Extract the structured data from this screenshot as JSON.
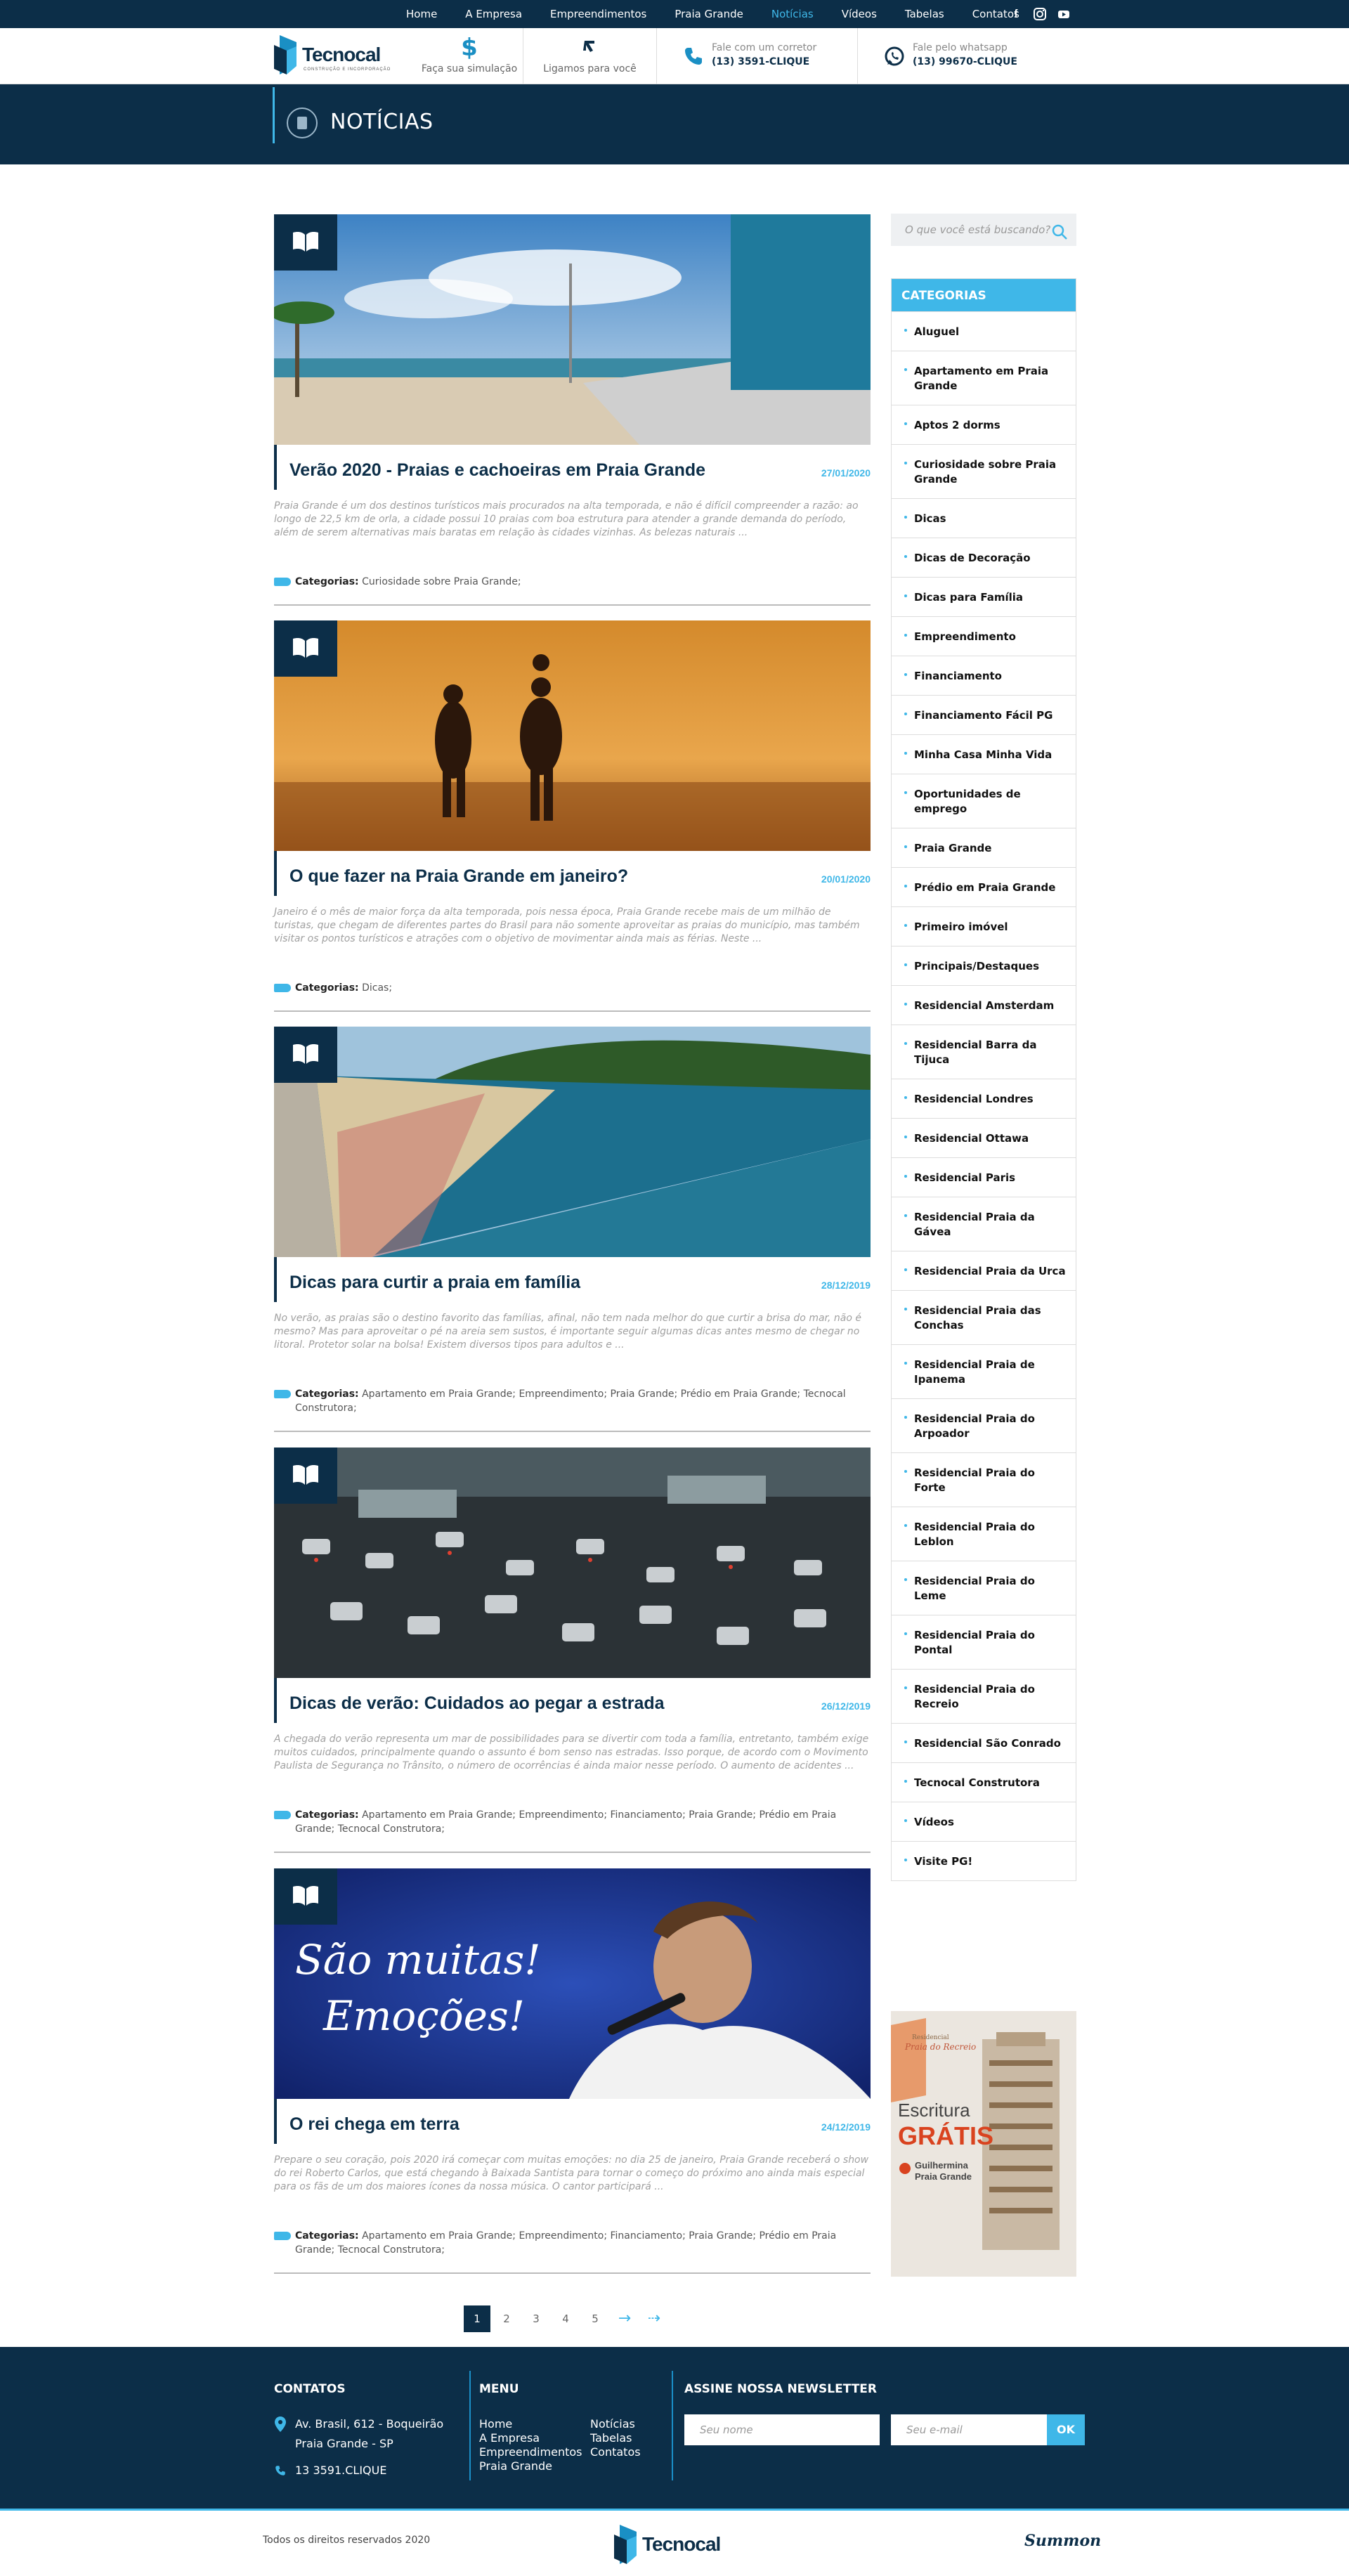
{
  "nav": {
    "items": [
      "Home",
      "A Empresa",
      "Empreendimentos",
      "Praia Grande",
      "Notícias",
      "Vídeos",
      "Tabelas",
      "Contatos"
    ],
    "active_index": 4,
    "social_icons": [
      "facebook-icon",
      "instagram-icon",
      "youtube-icon"
    ]
  },
  "header": {
    "logo_text": "Tecnocal",
    "logo_subtext": "CONSTRUÇÃO E INCORPORAÇÃO",
    "simulation_label": "Faça sua simulação",
    "callback_label": "Ligamos para você",
    "phone_label": "Fale com um corretor",
    "phone_value": "(13) 3591-CLIQUE",
    "whatsapp_label": "Fale pelo whatsapp",
    "whatsapp_value": "(13) 99670-CLIQUE"
  },
  "page": {
    "title": "NOTÍCIAS"
  },
  "posts": [
    {
      "title": "Verão 2020 - Praias e cachoeiras em Praia Grande",
      "date": "27/01/2020",
      "excerpt": "Praia Grande é um dos destinos turísticos mais procurados na alta temporada, e não é difícil compreender a razão: ao longo de 22,5 km de orla, a cidade possui 10 praias com boa estrutura para atender a grande demanda do período, além de serem alternativas mais baratas em relação às cidades vizinhas. As belezas naturais ...",
      "categories_label": "Categorias:",
      "categories": "Curiosidade sobre Praia Grande;"
    },
    {
      "title": "O que fazer na Praia Grande em janeiro?",
      "date": "20/01/2020",
      "excerpt": "Janeiro é o mês de maior força da alta temporada, pois nessa época, Praia Grande recebe mais de um milhão de turistas, que chegam de diferentes partes do Brasil para não somente aproveitar as praias do município, mas também visitar os pontos turísticos e atrações com o objetivo de movimentar ainda mais as férias. Neste ...",
      "categories_label": "Categorias:",
      "categories": "Dicas;"
    },
    {
      "title": "Dicas para curtir a praia em família",
      "date": "28/12/2019",
      "excerpt": "No verão, as praias são o destino favorito das famílias, afinal, não tem nada melhor do que curtir a brisa do mar, não é mesmo? Mas para aproveitar o pé na areia sem sustos, é importante seguir algumas dicas antes mesmo de chegar no litoral. Protetor solar na bolsa!  Existem diversos tipos para adultos e ...",
      "categories_label": "Categorias:",
      "categories": "Apartamento em Praia Grande; Empreendimento; Praia Grande; Prédio em Praia Grande; Tecnocal Construtora;"
    },
    {
      "title": "Dicas de verão: Cuidados ao pegar a estrada",
      "date": "26/12/2019",
      "excerpt": "A chegada do verão representa um mar de possibilidades para se divertir com toda a família, entretanto, também exige muitos cuidados, principalmente quando o assunto é bom senso nas estradas. Isso porque, de acordo com o Movimento Paulista de Segurança no Trânsito, o número de ocorrências é ainda maior nesse período.  O aumento de acidentes ...",
      "categories_label": "Categorias:",
      "categories": "Apartamento em Praia Grande; Empreendimento; Financiamento; Praia Grande; Prédio em Praia Grande; Tecnocal Construtora;"
    },
    {
      "title": "O rei chega em terra",
      "date": "24/12/2019",
      "excerpt": "Prepare o seu coração, pois 2020 irá começar com muitas emoções: no dia 25 de janeiro, Praia Grande receberá o show do rei Roberto Carlos, que está chegando à Baixada Santista para tornar o começo do próximo ano ainda mais especial para os fãs de um dos maiores ícones da nossa música. O cantor participará ...",
      "categories_label": "Categorias:",
      "categories": "Apartamento em Praia Grande; Empreendimento; Financiamento; Praia Grande; Prédio em Praia Grande; Tecnocal Construtora;",
      "image_text_1": "São muitas!",
      "image_text_2": "Emoções!"
    }
  ],
  "sidebar": {
    "search_placeholder": "O que você está buscando?",
    "categories_title": "CATEGORIAS",
    "categories": [
      "Aluguel",
      "Apartamento em Praia Grande",
      "Aptos 2 dorms",
      "Curiosidade sobre Praia Grande",
      "Dicas",
      "Dicas de Decoração",
      "Dicas para Família",
      "Empreendimento",
      "Financiamento",
      "Financiamento Fácil PG",
      "Minha Casa Minha Vida",
      "Oportunidades de emprego",
      "Praia Grande",
      "Prédio em Praia Grande",
      "Primeiro imóvel",
      "Principais/Destaques",
      "Residencial Amsterdam",
      "Residencial Barra da Tijuca",
      "Residencial Londres",
      "Residencial Ottawa",
      "Residencial Paris",
      "Residencial Praia da Gávea",
      "Residencial Praia da Urca",
      "Residencial Praia das Conchas",
      "Residencial Praia de Ipanema",
      "Residencial Praia do Arpoador",
      "Residencial Praia do Forte",
      "Residencial Praia do Leblon",
      "Residencial Praia do Leme",
      "Residencial Praia do Pontal",
      "Residencial Praia do Recreio",
      "Residencial São Conrado",
      "Tecnocal Construtora",
      "Vídeos",
      "Visite PG!"
    ],
    "ad": {
      "subtitle": "Residencial",
      "name": "Praia do Recreio",
      "headline_1": "Escritura",
      "headline_2": "GRÁTIS",
      "location_1": "Guilhermina",
      "location_2": "Praia Grande"
    }
  },
  "pagination": {
    "pages": [
      "1",
      "2",
      "3",
      "4",
      "5"
    ],
    "current": "1",
    "next": "→",
    "last": "⇢"
  },
  "footer": {
    "contacts_title": "CONTATOS",
    "address_1": "Av. Brasil, 612 - Boqueirão",
    "address_2": "Praia Grande - SP",
    "phone": "13 3591.CLIQUE",
    "menu_title": "MENU",
    "menu_col1": [
      "Home",
      "A Empresa",
      "Empreendimentos",
      "Praia Grande"
    ],
    "menu_col2": [
      "Notícias",
      "Tabelas",
      "Contatos"
    ],
    "newsletter_title": "ASSINE NOSSA NEWSLETTER",
    "name_placeholder": "Seu nome",
    "email_placeholder": "Seu e-mail",
    "ok_label": "OK",
    "copyright": "Todos os direitos reservados 2020",
    "agency": "Summon"
  },
  "colors": {
    "navy": "#0c2e48",
    "accent": "#3fb7e8"
  }
}
